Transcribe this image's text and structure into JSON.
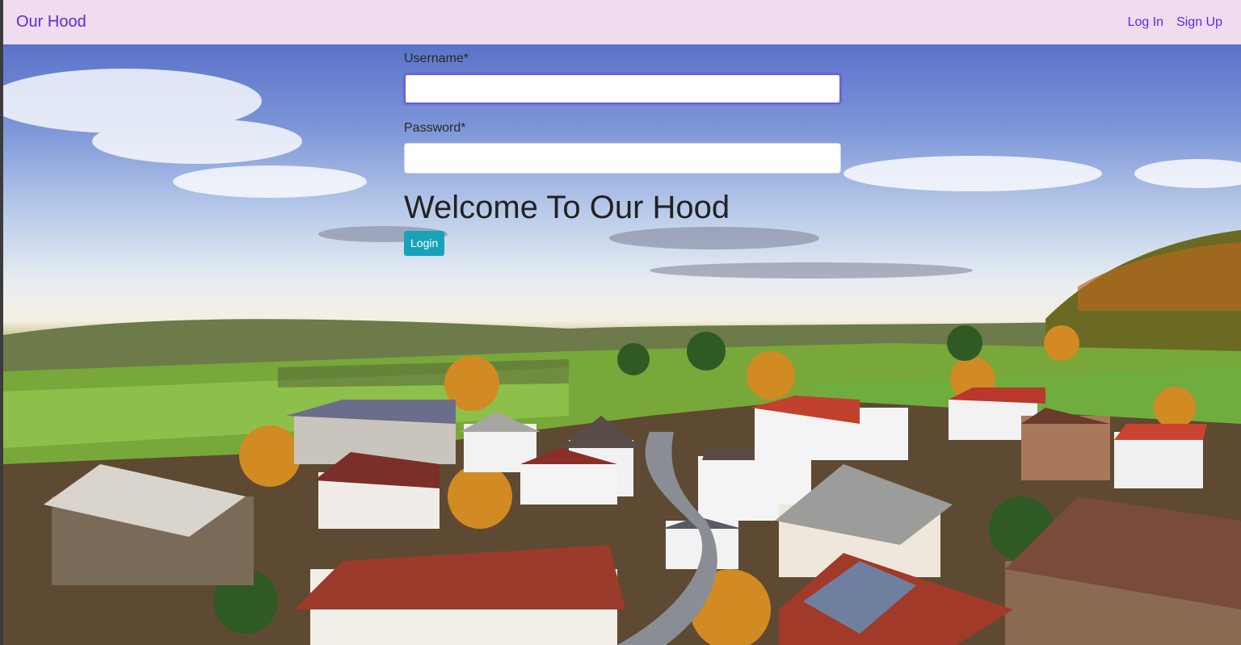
{
  "navbar": {
    "brand": "Our Hood",
    "links": [
      {
        "label": "Log In"
      },
      {
        "label": "Sign Up"
      }
    ]
  },
  "form": {
    "username_label": "Username*",
    "username_value": "",
    "password_label": "Password*",
    "password_value": "",
    "heading": "Welcome To Our Hood",
    "submit_label": "Login"
  },
  "colors": {
    "navbar_bg": "#efdcee",
    "link": "#5b2be0",
    "button": "#17a2b8"
  },
  "background": "village-landscape-photo"
}
